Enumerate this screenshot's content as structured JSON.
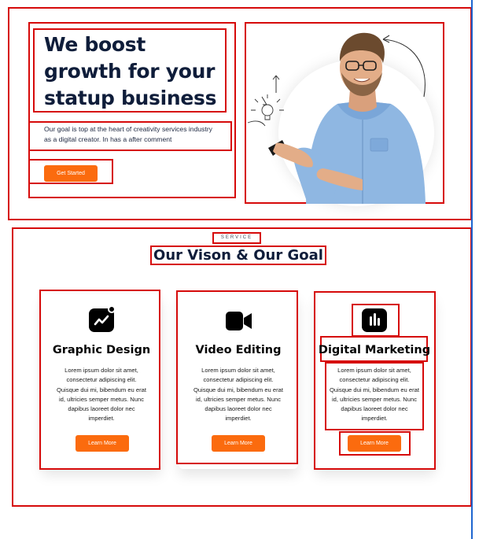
{
  "hero": {
    "title_line1": "We boost",
    "title_line2": "growth for your",
    "title_line3": "statup business",
    "description_line1": "Our goal is top at the heart of creativity services industry",
    "description_line2": "as a digital creator. In has a after comment",
    "cta_label": "Get Started",
    "accent_color": "#fb6b0e"
  },
  "services": {
    "eyebrow": "SERVICE",
    "heading": "Our Vison & Our Goal",
    "cards": [
      {
        "icon": "trending-chart-icon",
        "title": "Graphic Design",
        "body_lines": [
          "Lorem ipsum dolor sit amet,",
          "consectetur adipiscing elit.",
          "Quisque dui mi, bibendum eu erat",
          "id, ultricies semper metus. Nunc",
          "dapibus laoreet dolor nec",
          "imperdiet."
        ],
        "button_label": "Learn More"
      },
      {
        "icon": "video-camera-icon",
        "title": "Video Editing",
        "body_lines": [
          "Lorem ipsum dolor sit amet,",
          "consectetur adipiscing elit.",
          "Quisque dui mi, bibendum eu erat",
          "id, ultricies semper metus. Nunc",
          "dapibus laoreet dolor nec",
          "imperdiet."
        ],
        "button_label": "Learn More"
      },
      {
        "icon": "bar-chart-icon",
        "title": "Digital Marketing",
        "body_lines": [
          "Lorem ipsum dolor sit amet,",
          "consectetur adipiscing elit.",
          "Quisque dui mi, bibendum eu erat",
          "id, ultricies semper metus. Nunc",
          "dapibus laoreet dolor nec",
          "imperdiet."
        ],
        "button_label": "Learn More"
      }
    ]
  }
}
